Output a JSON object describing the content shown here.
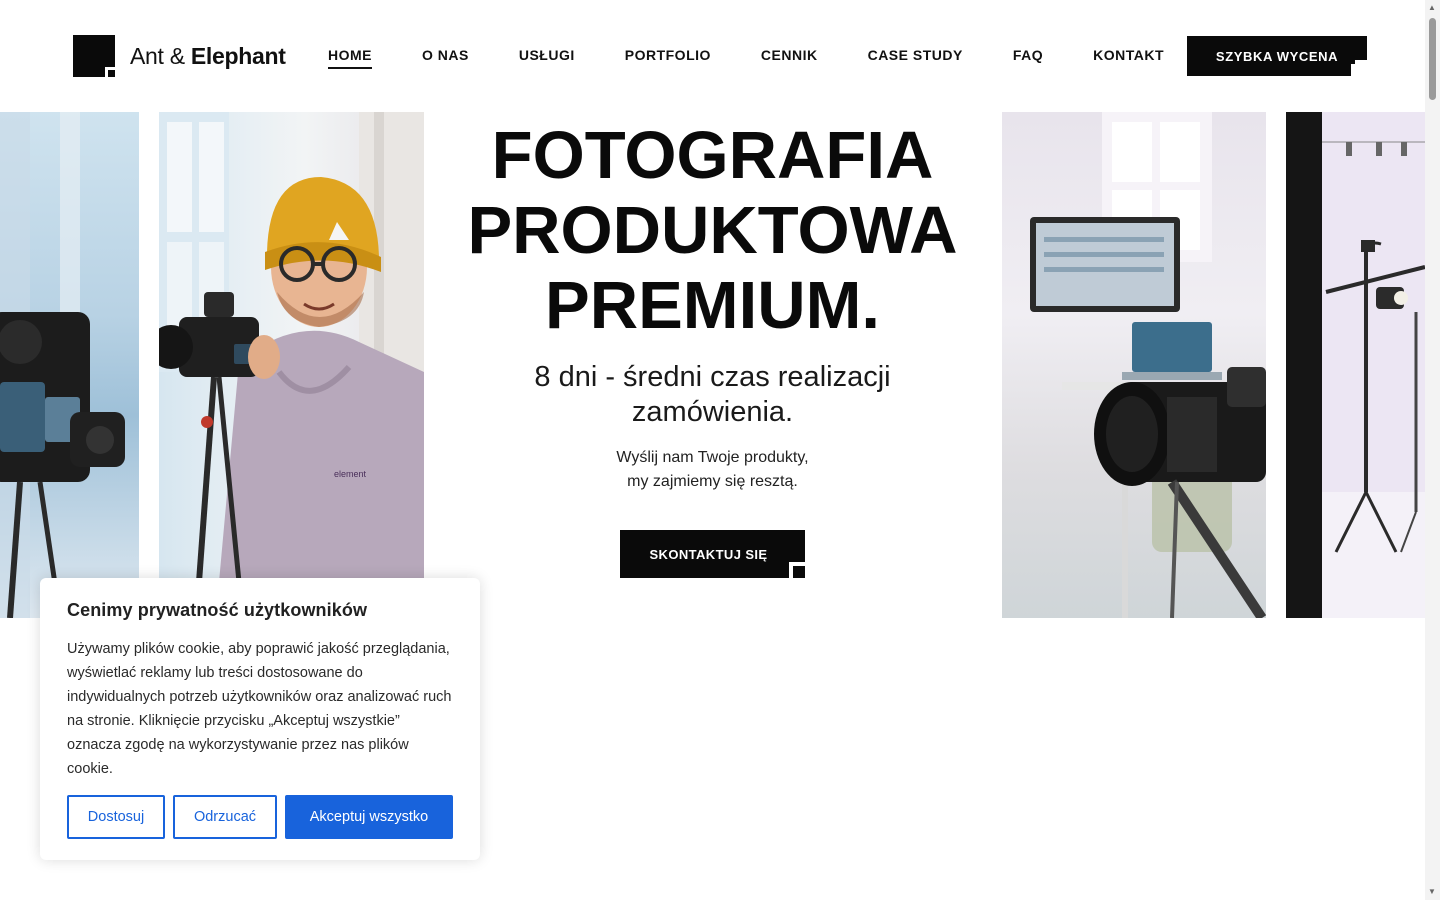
{
  "brand": {
    "name_light": "Ant &",
    "name_bold": "Elephant"
  },
  "nav": {
    "items": [
      {
        "label": "HOME",
        "active": true
      },
      {
        "label": "O NAS",
        "active": false
      },
      {
        "label": "USŁUGI",
        "active": false
      },
      {
        "label": "PORTFOLIO",
        "active": false
      },
      {
        "label": "CENNIK",
        "active": false
      },
      {
        "label": "CASE STUDY",
        "active": false
      },
      {
        "label": "FAQ",
        "active": false
      },
      {
        "label": "KONTAKT",
        "active": false
      }
    ],
    "cta_label": "SZYBKA WYCENA"
  },
  "hero": {
    "title_line1": "FOTOGRAFIA",
    "title_line2": "PRODUKTOWA",
    "title_line3": "PREMIUM.",
    "subtitle": "8 dni - średni czas realizacji zamówienia.",
    "desc_line1": "Wyślij nam Twoje produkty,",
    "desc_line2": "my zajmiemy się resztą.",
    "cta_label": "SKONTAKTUJ SIĘ"
  },
  "photos": {
    "hoodie_text": "element"
  },
  "cookie": {
    "title": "Cenimy prywatność użytkowników",
    "body": "Używamy plików cookie, aby poprawić jakość przeglądania, wyświetlać reklamy lub treści dostosowane do indywidualnych potrzeb użytkowników oraz analizować ruch na stronie. Kliknięcie przycisku „Akceptuj wszystkie” oznacza zgodę na wykorzystywanie przez nas plików cookie.",
    "customize_label": "Dostosuj",
    "reject_label": "Odrzucać",
    "accept_label": "Akceptuj wszystko"
  },
  "colors": {
    "brand_black": "#0a0a0a",
    "cookie_accent": "#1863dc"
  }
}
